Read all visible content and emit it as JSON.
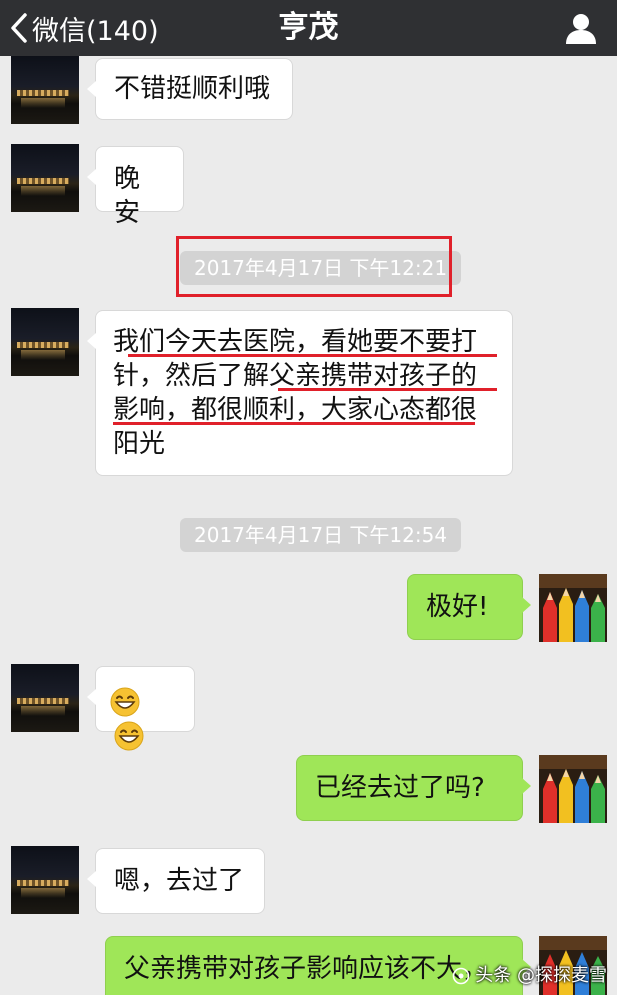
{
  "nav": {
    "back_label": "微信(140)",
    "title": "亨茂"
  },
  "messages": {
    "m1": "不错挺顺利哦",
    "m2": "晚安",
    "m3_line1": "我们今天去医院，看她要不要打",
    "m3_line2": "针，然后了解父亲携带对孩子的",
    "m3_line3": "影响，都很顺利，大家心态都很",
    "m3_line4": "阳光",
    "m4": "极好!",
    "m6": "已经去过了吗?",
    "m7": "嗯，去过了",
    "m8": "父亲携带对孩子影响应该不大，"
  },
  "timestamps": {
    "t1": "2017年4月17日 下午12:21",
    "t2": "2017年4月17日 下午12:54"
  },
  "emoji": [
    "grinning-face",
    "grinning-face"
  ],
  "watermark": "头条 @探探麦雪",
  "colors": {
    "nav_bg": "#2f3033",
    "chat_bg": "#ebebeb",
    "sent_bubble": "#9fe658",
    "received_bubble": "#ffffff",
    "annotation_red": "#e0202a"
  }
}
